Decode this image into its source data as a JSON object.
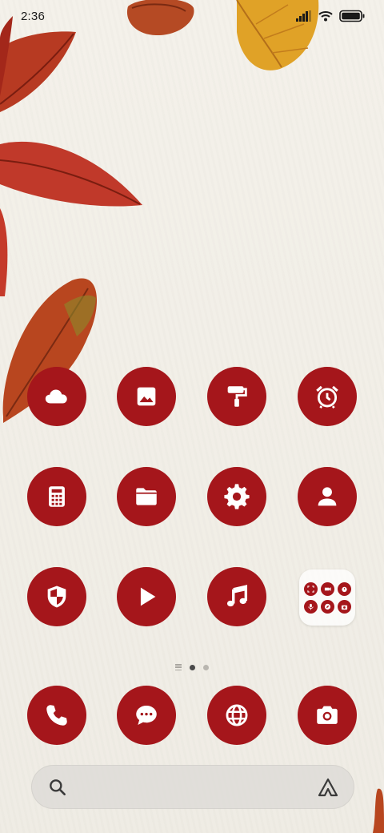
{
  "status_bar": {
    "time": "2:36",
    "icons": [
      "signal-icon",
      "wifi-icon",
      "battery-icon"
    ]
  },
  "theme": {
    "accent": "#a5161b",
    "icon_fg": "#ffffff"
  },
  "home": {
    "rows": [
      [
        "cloud-icon",
        "gallery-icon",
        "themes-icon",
        "clock-icon"
      ],
      [
        "calculator-icon",
        "file-manager-icon",
        "settings-icon",
        "contacts-icon"
      ],
      [
        "security-icon",
        "video-player-icon",
        "music-icon",
        "folder"
      ]
    ],
    "folder_apps": [
      "scanner-icon",
      "screen-recorder-icon",
      "stopwatch-icon",
      "voice-recorder-icon",
      "compass-icon",
      "camera-mini-icon"
    ]
  },
  "pages": {
    "count": 2,
    "current": 1
  },
  "dock": [
    "phone-icon",
    "messages-icon",
    "browser-icon",
    "camera-icon"
  ],
  "search": {
    "left_icon": "search-icon",
    "right_icon": "assistant-icon"
  }
}
